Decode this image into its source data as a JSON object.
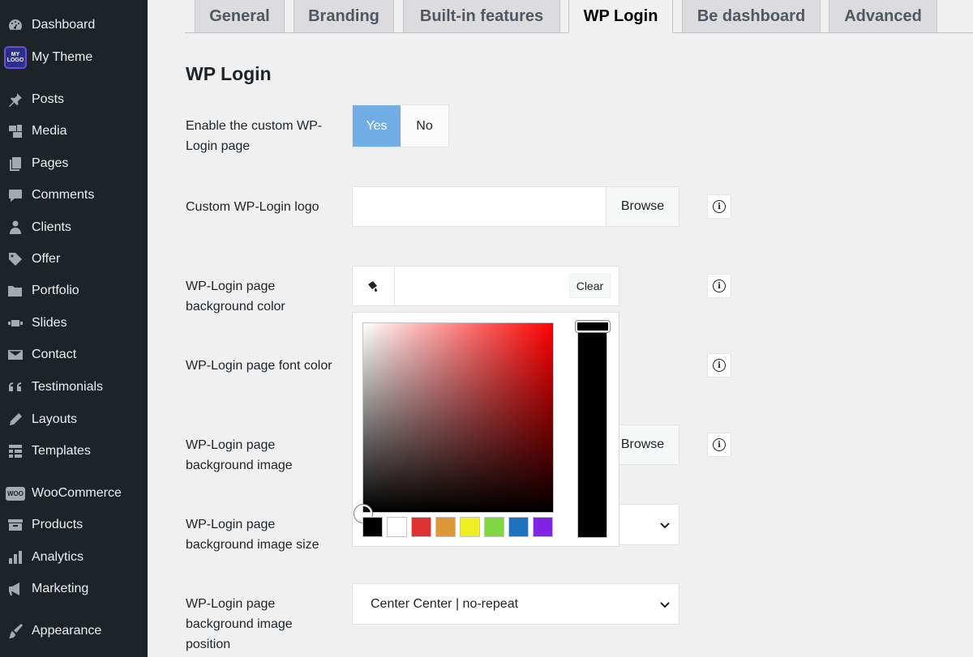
{
  "sidebar": {
    "items": [
      {
        "label": "Dashboard",
        "icon": "dashboard-icon"
      },
      {
        "label": "My Theme",
        "icon": "my-logo-icon",
        "badge": [
          "MY",
          "LOGO"
        ]
      },
      {
        "label": "Posts",
        "icon": "pin-icon"
      },
      {
        "label": "Media",
        "icon": "media-icon"
      },
      {
        "label": "Pages",
        "icon": "pages-icon"
      },
      {
        "label": "Comments",
        "icon": "comments-icon"
      },
      {
        "label": "Clients",
        "icon": "clients-icon"
      },
      {
        "label": "Offer",
        "icon": "tag-icon"
      },
      {
        "label": "Portfolio",
        "icon": "folder-icon"
      },
      {
        "label": "Slides",
        "icon": "slides-icon"
      },
      {
        "label": "Contact",
        "icon": "envelope-icon"
      },
      {
        "label": "Testimonials",
        "icon": "quote-icon"
      },
      {
        "label": "Layouts",
        "icon": "pencil-icon"
      },
      {
        "label": "Templates",
        "icon": "templates-icon"
      },
      {
        "label": "WooCommerce",
        "icon": "woo-icon",
        "badge_text": "WOO"
      },
      {
        "label": "Products",
        "icon": "products-icon"
      },
      {
        "label": "Analytics",
        "icon": "analytics-icon"
      },
      {
        "label": "Marketing",
        "icon": "megaphone-icon"
      },
      {
        "label": "Appearance",
        "icon": "paintbrush-icon"
      }
    ]
  },
  "tabs": [
    {
      "label": "General",
      "active": false
    },
    {
      "label": "Branding",
      "active": false
    },
    {
      "label": "Built-in features",
      "active": false
    },
    {
      "label": "WP Login",
      "active": true
    },
    {
      "label": "Be dashboard",
      "active": false
    },
    {
      "label": "Advanced",
      "active": false
    }
  ],
  "page": {
    "title": "WP Login",
    "fields": {
      "enable": {
        "label": "Enable the custom WP-Login page",
        "yes": "Yes",
        "no": "No",
        "value": "Yes"
      },
      "logo": {
        "label": "Custom WP-Login logo",
        "value": "",
        "browse": "Browse"
      },
      "bg_color": {
        "label": "WP-Login page background color",
        "value": "",
        "clear": "Clear"
      },
      "font_color": {
        "label": "WP-Login page font color"
      },
      "bg_image": {
        "label": "WP-Login page background image",
        "browse": "Browse"
      },
      "bg_size": {
        "label": "WP-Login page background image size",
        "value": ""
      },
      "bg_position": {
        "label": "WP-Login page background image position",
        "value": "Center Center | no-repeat"
      }
    },
    "info_glyph": "i"
  },
  "picker": {
    "palette": [
      "#000000",
      "#ffffff",
      "#dd3333",
      "#dd9933",
      "#eeee22",
      "#81d742",
      "#1e73be",
      "#8224e3"
    ],
    "hue_color": "#ff0000"
  },
  "colors": {
    "accent": "#72aee6",
    "sidebar_bg": "#1d2327"
  }
}
